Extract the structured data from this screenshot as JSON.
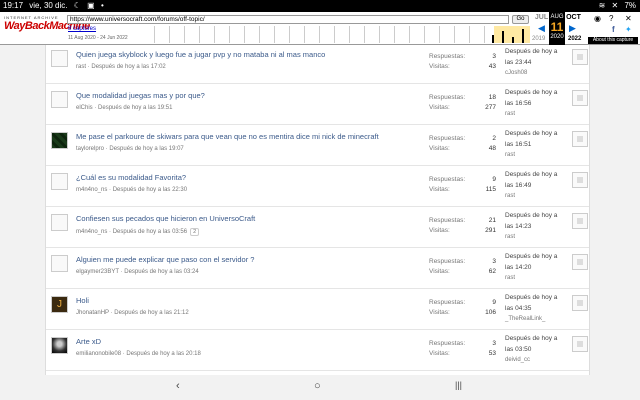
{
  "status": {
    "time": "19:17",
    "date": "vie, 30 dic.",
    "battery": "7%"
  },
  "wayback": {
    "logo_top": "INTERNET ARCHIVE",
    "logo_main": "WayBackMachine",
    "url": "https://www.universocraft.com/forums/off-topic/",
    "go_label": "Go",
    "captures": "8 captures",
    "range": "11 Aug 2020 - 24 Jun 2022",
    "prev_month": "JUL",
    "cur_month": "AUG",
    "next_month": "OCT",
    "cur_day": "11",
    "prev_year": "2019",
    "cur_year": "2020",
    "next_year": "2022",
    "about": "About this capture"
  },
  "threads": [
    {
      "title": "Quien juega skyblock y luego fue a jugar pvp y no mataba ni al mas manco",
      "author": "rast",
      "posted": "Después de hoy a las 17:02",
      "replies": "3",
      "views": "43",
      "last_time": "Después de hoy a las 23:44",
      "last_user": "cJosh08",
      "avatar": "img"
    },
    {
      "title": "Que modalidad juegas mas y por que?",
      "author": "elChis",
      "posted": "Después de hoy a las 19:51",
      "replies": "18",
      "views": "277",
      "last_time": "Después de hoy a las 16:56",
      "last_user": "rast",
      "avatar": "img"
    },
    {
      "title": "Me pase el parkoure de skiwars para que vean que no es mentira dice mi nick de minecraft",
      "author": "taylorelpro",
      "posted": "Después de hoy a las 19:07",
      "replies": "2",
      "views": "48",
      "last_time": "Después de hoy a las 16:51",
      "last_user": "rast",
      "avatar": "mc"
    },
    {
      "title": "¿Cuál es su modalidad Favorita?",
      "author": "m4n4no_ns",
      "posted": "Después de hoy a las 22:30",
      "replies": "9",
      "views": "115",
      "last_time": "Después de hoy a las 16:49",
      "last_user": "rast",
      "avatar": "img"
    },
    {
      "title": "Confiesen sus pecados que hicieron en UniversoCraft",
      "author": "m4n4no_ns",
      "posted": "Después de hoy a las 03:56",
      "badge": "2",
      "replies": "21",
      "views": "291",
      "last_time": "Después de hoy a las 14:23",
      "last_user": "rast",
      "avatar": "img"
    },
    {
      "title": "Alguien me puede explicar que paso con el servidor ?",
      "author": "elgaymer23BYT",
      "posted": "Después de hoy a las 03:24",
      "replies": "3",
      "views": "62",
      "last_time": "Después de hoy a las 14:20",
      "last_user": "rast",
      "avatar": "img"
    },
    {
      "title": "Holi",
      "author": "JhonatanHP",
      "posted": "Después de hoy a las 21:12",
      "replies": "9",
      "views": "106",
      "last_time": "Después de hoy a las 04:35",
      "last_user": "_TheRealLink_",
      "avatar": "j"
    },
    {
      "title": "Arte xD",
      "author": "emilianonobile08",
      "posted": "Después de hoy a las 20:18",
      "replies": "3",
      "views": "53",
      "last_time": "Después de hoy a las 03:50",
      "last_user": "deivid_cc",
      "avatar": "dark"
    }
  ],
  "labels": {
    "replies": "Respuestas:",
    "views": "Visitas:"
  },
  "nav": {
    "back": "‹",
    "home": "○",
    "recents": "|||"
  }
}
